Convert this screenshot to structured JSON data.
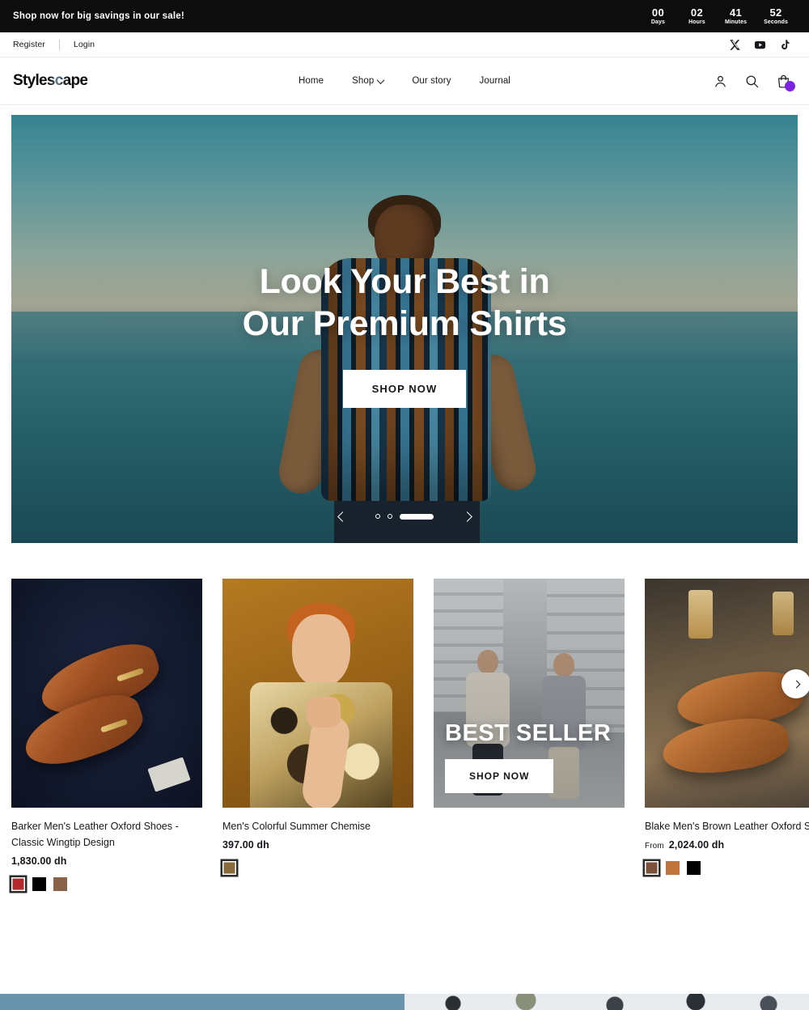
{
  "announcement": {
    "text": "Shop now for big savings in our sale!",
    "countdown": [
      {
        "value": "00",
        "label": "Days"
      },
      {
        "value": "02",
        "label": "Hours"
      },
      {
        "value": "41",
        "label": "Minutes"
      },
      {
        "value": "52",
        "label": "Seconds"
      }
    ]
  },
  "utility": {
    "register": "Register",
    "login": "Login",
    "socials": [
      "x-icon",
      "youtube-icon",
      "tiktok-icon"
    ]
  },
  "header": {
    "logo": "Stylescape",
    "nav": [
      {
        "label": "Home",
        "has_dropdown": false
      },
      {
        "label": "Shop",
        "has_dropdown": true
      },
      {
        "label": "Our story",
        "has_dropdown": false
      },
      {
        "label": "Journal",
        "has_dropdown": false
      }
    ],
    "actions": [
      "account-icon",
      "search-icon",
      "cart-icon"
    ],
    "cart_badge_color": "#7b23e0"
  },
  "hero": {
    "title_line1": "Look Your Best in",
    "title_line2": "Our Premium Shirts",
    "button": "SHOP NOW",
    "slides": 3,
    "active_slide": 3,
    "prev_label": "Previous slide",
    "next_label": "Next slide"
  },
  "products": [
    {
      "title": "Barker Men's Leather Oxford Shoes - Classic Wingtip Design",
      "price": "1,830.00 dh",
      "price_prefix": "",
      "swatches": [
        {
          "name": "red",
          "color": "#b3292c",
          "selected": true
        },
        {
          "name": "black",
          "color": "#000000",
          "selected": false
        },
        {
          "name": "brown",
          "color": "#8a6248",
          "selected": false
        }
      ]
    },
    {
      "title": "Men's Colorful Summer Chemise",
      "price": "397.00 dh",
      "price_prefix": "",
      "swatches": [
        {
          "name": "patterned",
          "color": "#8a6a3b",
          "selected": true
        }
      ]
    },
    {
      "title": "Blake Men's Brown Leather Oxford Shoes",
      "price": "2,024.00 dh",
      "price_prefix": "From",
      "swatches": [
        {
          "name": "brown",
          "color": "#7d513a",
          "selected": true
        },
        {
          "name": "tan",
          "color": "#c0743a",
          "selected": false
        },
        {
          "name": "black",
          "color": "#000000",
          "selected": false
        }
      ]
    }
  ],
  "promo": {
    "title": "BEST SELLER",
    "button": "SHOP NOW"
  }
}
